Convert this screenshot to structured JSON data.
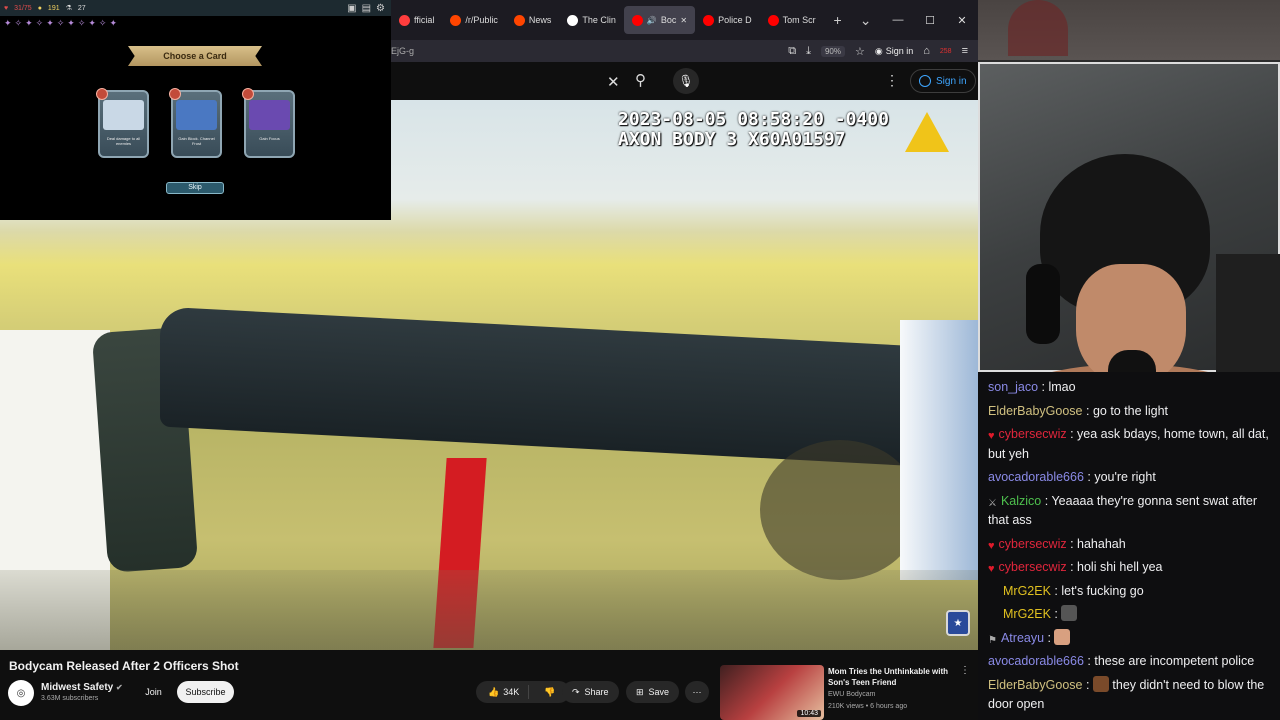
{
  "browser": {
    "tabs": [
      {
        "label": "fficial",
        "color": "#ff3d3d"
      },
      {
        "label": "/r/Public",
        "color": "#ff4500"
      },
      {
        "label": "News",
        "color": "#ff4500"
      },
      {
        "label": "The Clin",
        "color": "#ffffff"
      },
      {
        "label": "Boc",
        "color": "#ff0000"
      },
      {
        "label": "Police D",
        "color": "#ff0000"
      },
      {
        "label": "Tom Scr",
        "color": "#ff0000"
      }
    ],
    "new_tab": "+",
    "tab_list": "⌄",
    "url_tail": "EjG-g",
    "zoom": "90%",
    "sign_in": "Sign in",
    "badge_count": "258"
  },
  "youtube": {
    "sign_in": "Sign in"
  },
  "video": {
    "timestamp": "2023-08-05 08:58:20 -0400",
    "device": "AXON BODY 3 X60A01597"
  },
  "game": {
    "hp": "31/75",
    "gold": "191",
    "misc": "27",
    "banner": "Choose a Card",
    "cards": [
      {
        "text": "Deal damage to all enemies",
        "art": "#c9d8e6"
      },
      {
        "text": "Gain Block. Channel Frost",
        "art": "#4a78c2"
      },
      {
        "text": "Gain Focus",
        "art": "#6a4ab0"
      }
    ],
    "skip": "Skip"
  },
  "chat": [
    {
      "badge": "none",
      "user": "son_jaco",
      "color": "#8a8ae6",
      "text": "lmao"
    },
    {
      "badge": "none",
      "user": "ElderBabyGoose",
      "color": "#d0c080",
      "text": "go to the light"
    },
    {
      "badge": "heart",
      "user": "cybersecwiz",
      "color": "#e0263c",
      "text": "yea ask bdays, home town, all dat, but yeh"
    },
    {
      "badge": "none",
      "user": "avocadorable666",
      "color": "#8a8ae6",
      "text": "you're right"
    },
    {
      "badge": "sword",
      "user": "Kalzico",
      "color": "#4ec04e",
      "text": "Yeaaaa they're gonna sent swat after that ass"
    },
    {
      "badge": "heart",
      "user": "cybersecwiz",
      "color": "#e0263c",
      "text": "hahahah"
    },
    {
      "badge": "heart",
      "user": "cybersecwiz",
      "color": "#e0263c",
      "text": "holi shi hell yea"
    },
    {
      "badge": "blank",
      "user": "MrG2EK",
      "color": "#e0c020",
      "text": "let's fucking go"
    },
    {
      "badge": "blank",
      "user": "MrG2EK",
      "color": "#e0c020",
      "text": ""
    },
    {
      "badge": "flag",
      "user": "Atreayu",
      "color": "#8a8ae6",
      "text": ""
    },
    {
      "badge": "none",
      "user": "avocadorable666",
      "color": "#8a8ae6",
      "text": "these are incompetent police"
    },
    {
      "badge": "none",
      "user": "ElderBabyGoose",
      "color": "#d0c080",
      "text": "they didn't need to blow the door open"
    }
  ],
  "below": {
    "title": "Bodycam Released After 2 Officers Shot",
    "channel": "Midwest Safety",
    "subs": "3.63M subscribers",
    "join": "Join",
    "subscribe": "Subscribe",
    "likes": "34K",
    "share": "Share",
    "save": "Save"
  },
  "next": {
    "title": "Mom Tries the Unthinkable with Son's Teen Friend",
    "channel": "EWU Bodycam",
    "meta": "210K views • 6 hours ago",
    "duration": "10:43"
  }
}
